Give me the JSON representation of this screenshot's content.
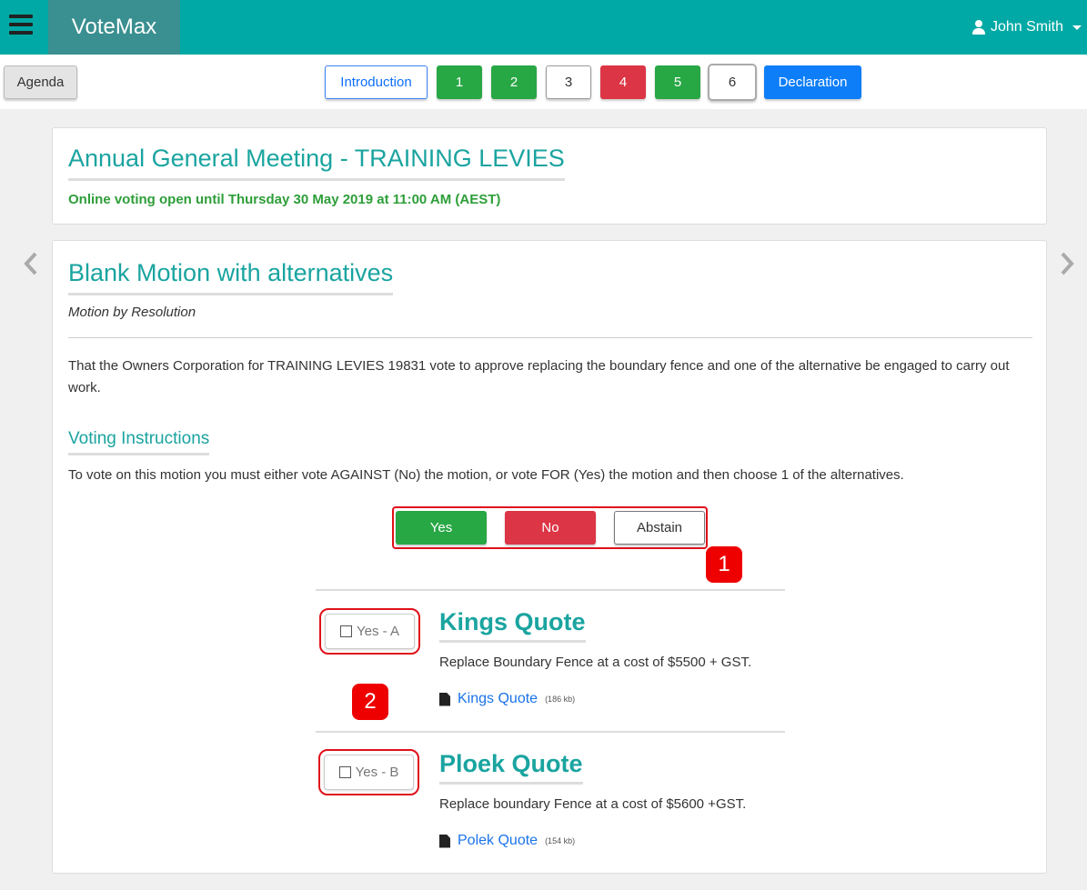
{
  "header": {
    "brand": "VoteMax",
    "user_name": "John Smith"
  },
  "nav": {
    "agenda_label": "Agenda",
    "steps": [
      {
        "label": "Introduction"
      },
      {
        "label": "1"
      },
      {
        "label": "2"
      },
      {
        "label": "3"
      },
      {
        "label": "4"
      },
      {
        "label": "5"
      },
      {
        "label": "6"
      },
      {
        "label": "Declaration"
      }
    ]
  },
  "meeting": {
    "title": "Annual General Meeting - TRAINING LEVIES",
    "voting_status": "Online voting open until Thursday 30 May 2019 at 11:00 AM (AEST)"
  },
  "motion": {
    "title": "Blank Motion with alternatives",
    "type": "Motion by Resolution",
    "text": "That the Owners Corporation for TRAINING LEVIES 19831 vote to approve replacing the boundary fence and one of the alternative be engaged to carry out work.",
    "instructions_heading": "Voting Instructions",
    "instructions_text": "To vote on this motion you must either vote AGAINST (No) the motion, or vote FOR (Yes) the motion and then choose 1 of the alternatives.",
    "vote_options": {
      "yes": "Yes",
      "no": "No",
      "abstain": "Abstain"
    },
    "alternatives": [
      {
        "check_label": "Yes - A",
        "title": "Kings Quote",
        "description": "Replace Boundary Fence at a cost of $5500 + GST.",
        "file_link": "Kings Quote",
        "file_size": "(186 kb)"
      },
      {
        "check_label": "Yes - B",
        "title": "Ploek Quote",
        "description": "Replace boundary Fence at a cost of $5600 +GST.",
        "file_link": "Polek Quote",
        "file_size": "(154 kb)"
      }
    ]
  },
  "annotations": {
    "badge_1": "1",
    "badge_2": "2"
  },
  "colors": {
    "header_bg": "#00a9a5",
    "brand_bg": "#3a8f90",
    "accent_teal": "#1aa4a0",
    "green": "#28a745",
    "red": "#dc3545",
    "blue": "#0d7ef8",
    "annotation_red": "#ee0000"
  },
  "icons": {
    "menu": "hamburger-icon",
    "user": "user-icon",
    "dropdown": "caret-down-icon",
    "prev": "chevron-left-icon",
    "next": "chevron-right-icon",
    "checkbox": "checkbox-icon",
    "file": "document-icon"
  }
}
